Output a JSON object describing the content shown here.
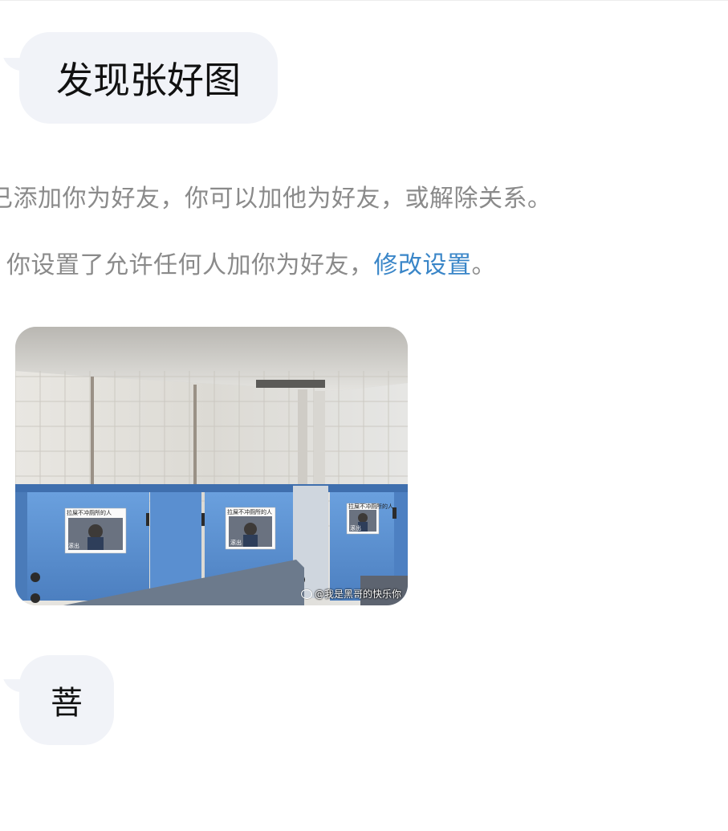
{
  "chat": {
    "message_1": "发现张好图",
    "notice_1": "已添加你为好友，你可以加他为好友，或解除关系。",
    "notice_2_prefix": "你设置了允许任何人加你为好友，",
    "notice_2_link": "修改设置",
    "notice_2_suffix": "。",
    "message_2": "菩"
  },
  "photo": {
    "poster_caption_top": "拉屎不冲厕所的人",
    "poster_caption_bottom": "滚出",
    "watermark": "@我是黑哥的快乐你"
  },
  "colors": {
    "bubble": "#f1f3f8",
    "notice_text": "#8a8a8a",
    "link": "#3a86c8",
    "partition_blue": "#5a8fd0"
  }
}
